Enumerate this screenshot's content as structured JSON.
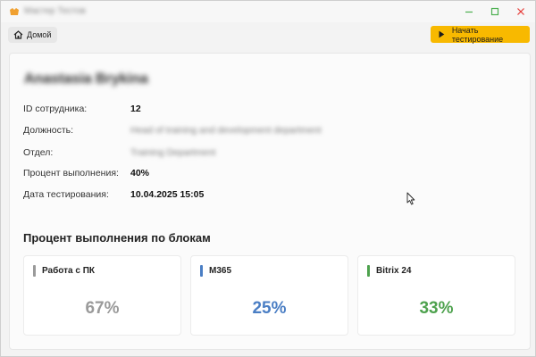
{
  "titlebar": {
    "title": "Мастер Тестов",
    "icons": [
      "app-icon",
      "minimize-icon",
      "maximize-icon",
      "close-icon"
    ]
  },
  "toolbar": {
    "home_label": "Домой",
    "home_icon": "home-icon",
    "start_label": "Начать тестирование",
    "start_icon": "play-icon",
    "accent": "#f8b900"
  },
  "employee": {
    "name": "Anastasia Brykina",
    "rows": [
      {
        "label": "ID сотрудника:",
        "value": "12"
      },
      {
        "label": "Должность:",
        "value": "Head of training and development department"
      },
      {
        "label": "Отдел:",
        "value": "Training Department"
      },
      {
        "label": "Процент выполнения:",
        "value": "40%"
      },
      {
        "label": "Дата тестирования:",
        "value": "10.04.2025 15:05"
      }
    ]
  },
  "blocks": {
    "title": "Процент выполнения по блокам",
    "items": [
      {
        "name": "Работа с ПК",
        "percent": "67%",
        "color": "#9a9a9a"
      },
      {
        "name": "M365",
        "percent": "25%",
        "color": "#4a7ec4"
      },
      {
        "name": "Bitrix 24",
        "percent": "33%",
        "color": "#4ea24e"
      }
    ]
  }
}
